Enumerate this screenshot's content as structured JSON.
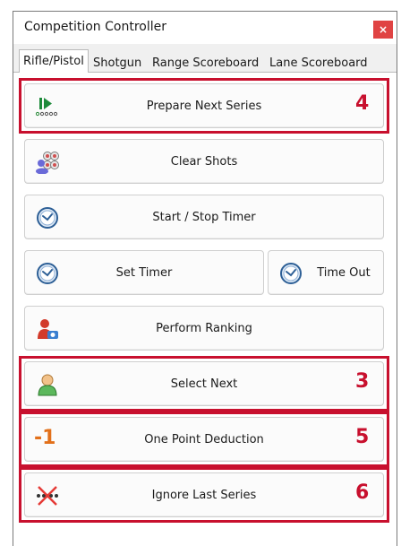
{
  "window": {
    "title": "Competition Controller",
    "close_glyph": "×"
  },
  "tabs": [
    {
      "label": "Rifle/Pistol",
      "active": true
    },
    {
      "label": "Shotgun"
    },
    {
      "label": "Range Scoreboard"
    },
    {
      "label": "Lane Scoreboard"
    }
  ],
  "buttons": {
    "prepare_next_series": {
      "label": "Prepare Next Series",
      "icon": "play-next-icon"
    },
    "clear_shots": {
      "label": "Clear Shots",
      "icon": "targets-icon"
    },
    "start_stop_timer": {
      "label": "Start / Stop Timer",
      "icon": "clock-icon"
    },
    "set_timer": {
      "label": "Set Timer",
      "icon": "clock-icon"
    },
    "time_out": {
      "label": "Time Out",
      "icon": "clock-icon"
    },
    "perform_ranking": {
      "label": "Perform Ranking",
      "icon": "ranking-icon"
    },
    "select_next": {
      "label": "Select Next",
      "icon": "user-icon"
    },
    "one_point_deduction": {
      "label": "One Point Deduction",
      "icon_text": "-1"
    },
    "ignore_last_series": {
      "label": "Ignore Last Series",
      "icon": "ignore-series-icon"
    }
  },
  "annotations": {
    "prepare_next_series": "4",
    "select_next": "3",
    "one_point_deduction": "5",
    "ignore_last_series": "6"
  },
  "colors": {
    "highlight": "#c8102e",
    "close_button": "#e04343"
  }
}
